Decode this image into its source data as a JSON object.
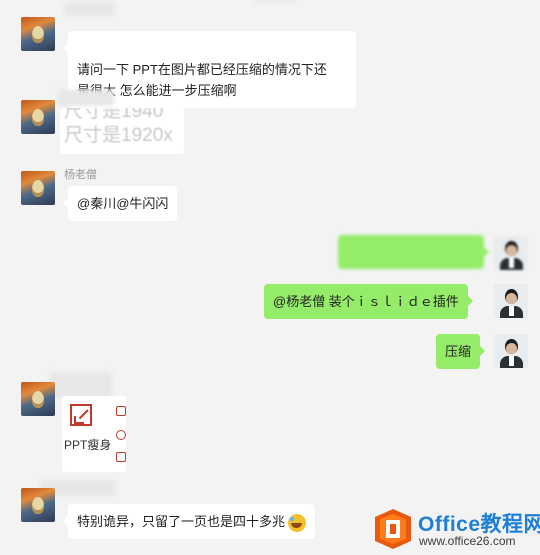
{
  "messages": {
    "m1": {
      "text": "请问一下  PPT在图片都已经压缩的情况下还\n是很大  怎么能进一步压缩啊"
    },
    "m2": {
      "line1": "尺寸是1940",
      "line2": "尺寸是1920x"
    },
    "m3": {
      "sender": "杨老僧",
      "text": "@秦川@牛闪闪"
    },
    "m4": {
      "text": ""
    },
    "m5": {
      "text": "@杨老僧 装个ｉｓｌｉｄｅ插件"
    },
    "m6": {
      "text": "压缩"
    },
    "m7": {
      "card_label": "PPT瘦身"
    },
    "m8": {
      "text": "特别诡异，只留了一页也是四十多兆"
    }
  },
  "watermark": {
    "title": "Office教程网",
    "url": "www.office26.com"
  },
  "colors": {
    "bubble_green": "#95ec69",
    "bubble_white": "#ffffff",
    "background": "#f3f3f3",
    "brand_orange": "#e8590c",
    "brand_blue": "#1e7fd8"
  },
  "icons": [
    "scream-avatar",
    "suit-avatar",
    "compress-icon",
    "crying-emoji-icon",
    "office-logo-icon"
  ]
}
